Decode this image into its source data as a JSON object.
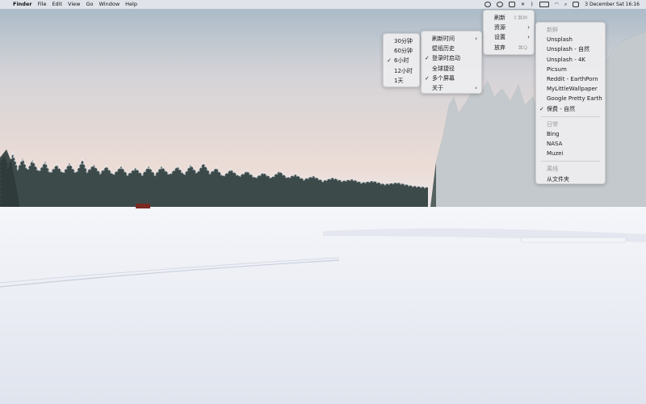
{
  "menubar": {
    "app_name": "Finder",
    "menus": [
      "File",
      "Edit",
      "View",
      "Go",
      "Window",
      "Help"
    ],
    "clock": "3 December Sat  16:16"
  },
  "main_menu": {
    "items": [
      {
        "label": "刷新",
        "shortcut": "⇧⌘M"
      },
      {
        "label": "资源",
        "submenu": true
      },
      {
        "label": "设置",
        "submenu": true
      },
      {
        "label": "放弃",
        "shortcut": "⌘Q"
      }
    ]
  },
  "sources_menu": {
    "group1_header": "新鲜",
    "group1": [
      {
        "label": "Unsplash",
        "checked": false
      },
      {
        "label": "Unsplash - 自然",
        "checked": false
      },
      {
        "label": "Unsplash - 4K",
        "checked": false
      },
      {
        "label": "Picsum",
        "checked": false
      },
      {
        "label": "Reddit - EarthPorn",
        "checked": false
      },
      {
        "label": "MyLittleWallpaper",
        "checked": false
      },
      {
        "label": "Google Pretty Earth",
        "checked": false
      },
      {
        "label": "保费 - 自然",
        "checked": true
      }
    ],
    "group2_header": "日常",
    "group2": [
      {
        "label": "Bing"
      },
      {
        "label": "NASA"
      },
      {
        "label": "Muzei"
      }
    ],
    "group3_header": "离线",
    "group3": [
      {
        "label": "从文件夹"
      }
    ]
  },
  "settings_menu": {
    "items": [
      {
        "label": "刷新时间",
        "checked": false,
        "submenu": true
      },
      {
        "label": "壁纸历史",
        "checked": false
      },
      {
        "label": "登录时启动",
        "checked": true
      },
      {
        "label": "全球捷径",
        "checked": false
      },
      {
        "label": "多个屏幕",
        "checked": true
      },
      {
        "label": "关于",
        "checked": false,
        "submenu": true
      }
    ]
  },
  "interval_menu": {
    "items": [
      {
        "label": "30分钟",
        "checked": false
      },
      {
        "label": "60分钟",
        "checked": false
      },
      {
        "label": "6小时",
        "checked": true
      },
      {
        "label": "12小时",
        "checked": false
      },
      {
        "label": "1天",
        "checked": false
      }
    ]
  },
  "glyphs": {
    "apple": "",
    "check": "✓",
    "chevron": "›"
  }
}
